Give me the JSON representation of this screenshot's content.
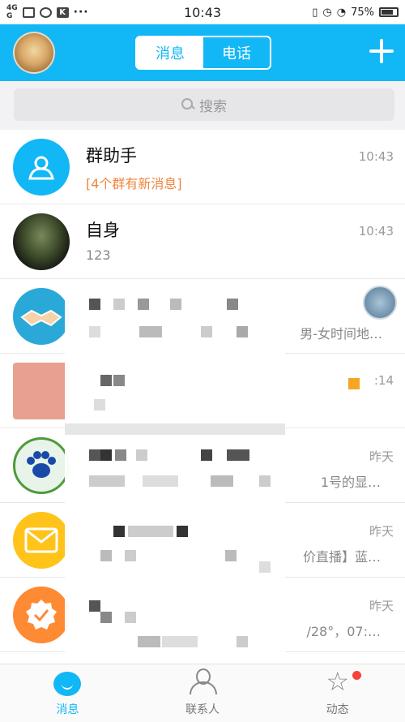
{
  "status_bar": {
    "signal_top": "4G",
    "signal_bottom": "G",
    "time": "10:43",
    "battery": "75%"
  },
  "header": {
    "tabs": [
      {
        "label": "消息",
        "active": true
      },
      {
        "label": "电话",
        "active": false
      }
    ]
  },
  "search": {
    "placeholder": "搜索"
  },
  "conversations": [
    {
      "name": "群助手",
      "message": "[4个群有新消息]",
      "time": "10:43",
      "avatar_icon": "group-helper-icon"
    },
    {
      "name": "自身",
      "message": "123",
      "time": "10:43",
      "avatar_icon": "landscape-photo"
    },
    {
      "name": "",
      "message": "男-女时间地…",
      "time": "",
      "avatar_icon": "handshake-icon"
    },
    {
      "name": "",
      "message": "",
      "time": ":14",
      "avatar_icon": "blurred-photo"
    },
    {
      "name": "",
      "message": "1号的显…",
      "time": "昨天",
      "avatar_icon": "paw-logo"
    },
    {
      "name": "",
      "message": "价直播】蓝…",
      "time": "昨天",
      "avatar_icon": "mail-icon"
    },
    {
      "name": "",
      "message": "/28°，07:…",
      "time": "昨天",
      "avatar_icon": "badge-check-icon"
    }
  ],
  "tabbar": [
    {
      "label": "消息",
      "active": true,
      "icon": "chat-bubble-icon"
    },
    {
      "label": "联系人",
      "active": false,
      "icon": "contacts-icon"
    },
    {
      "label": "动态",
      "active": false,
      "icon": "star-icon"
    }
  ],
  "colors": {
    "accent": "#12b7f5",
    "highlight": "#f0843c",
    "badge": "#f4433a"
  }
}
